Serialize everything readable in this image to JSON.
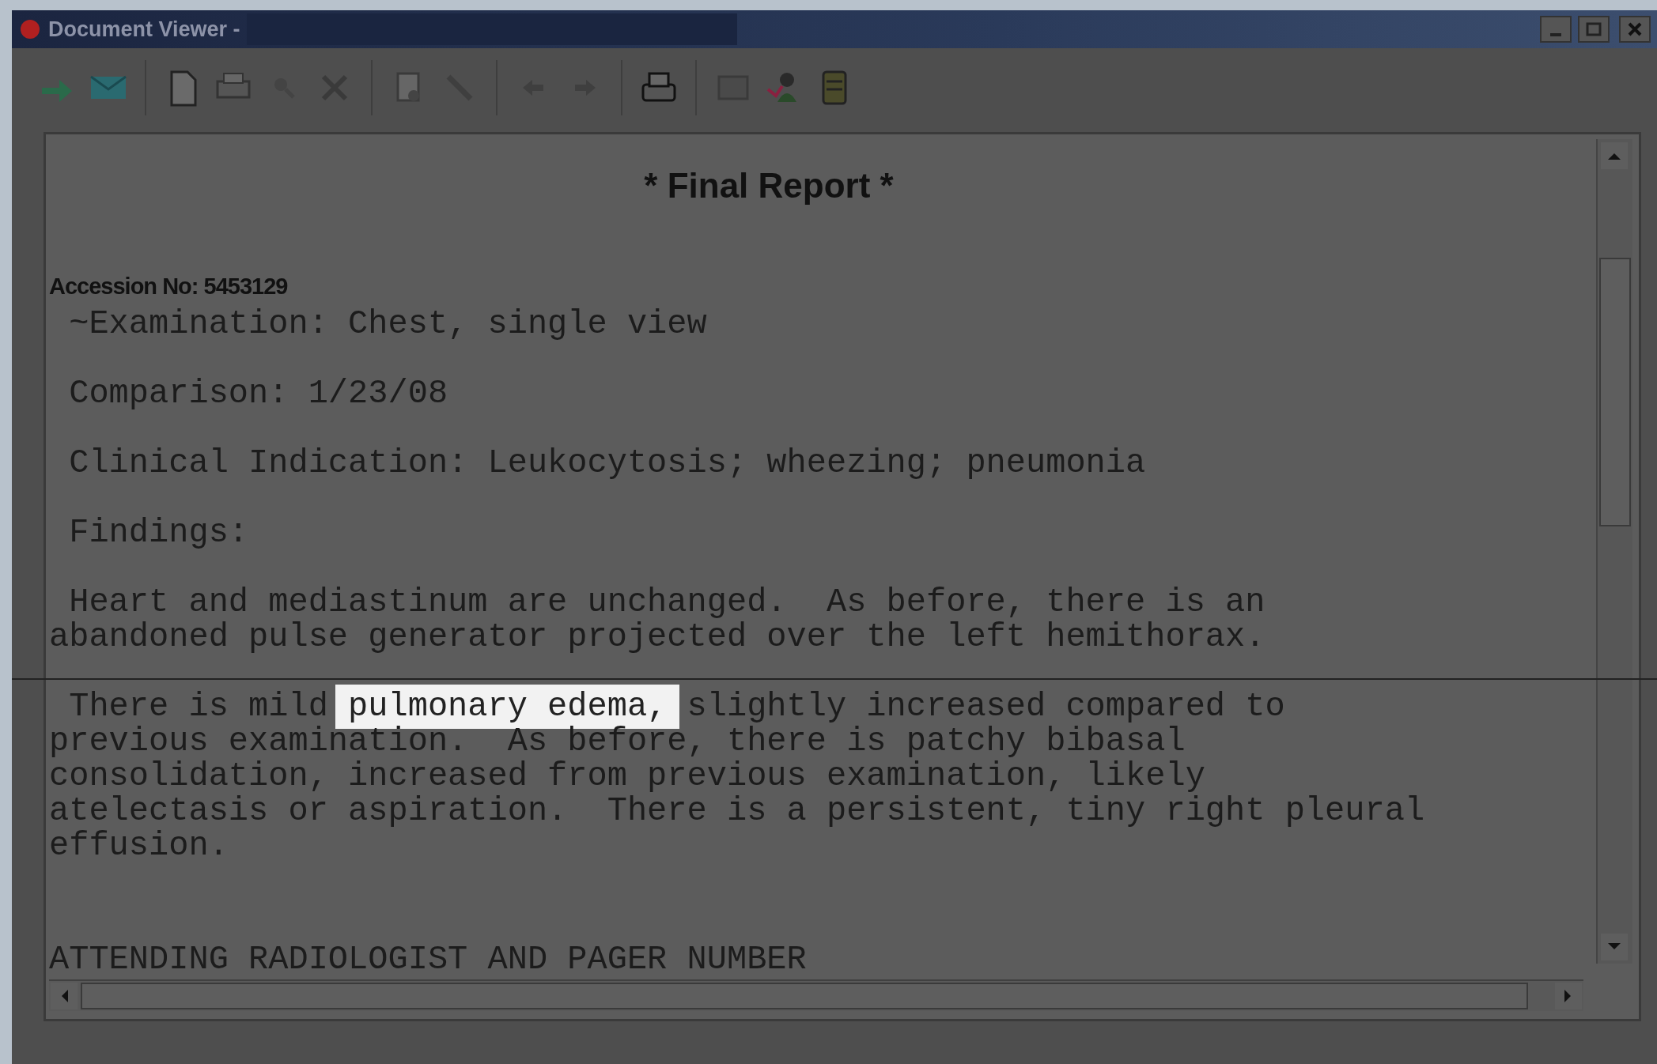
{
  "window": {
    "title": "Document Viewer -"
  },
  "document": {
    "title": "* Final Report *",
    "accession": "Accession No: 5453129",
    "paragraphs": [
      {
        "kind": "paragraph",
        "segments": [
          {
            "text": "~Examination: Chest, single view",
            "highlighted": false
          }
        ]
      },
      {
        "kind": "paragraph",
        "segments": [
          {
            "text": "Comparison: 1/23/08",
            "highlighted": false
          }
        ]
      },
      {
        "kind": "paragraph",
        "segments": [
          {
            "text": "Clinical Indication: Leukocytosis; wheezing; pneumonia",
            "highlighted": false
          }
        ]
      },
      {
        "kind": "paragraph",
        "segments": [
          {
            "text": "Findings:",
            "highlighted": false
          }
        ]
      },
      {
        "kind": "paragraph",
        "segments": [
          {
            "text": "Heart and mediastinum are unchanged.  As before, there is an\nabandoned pulse generator projected over the left hemithorax.",
            "highlighted": false
          }
        ]
      },
      {
        "kind": "paragraph",
        "segments": [
          {
            "text": "There is mild ",
            "highlighted": false
          },
          {
            "text": "pulmonary edema,",
            "highlighted": true
          },
          {
            "text": " slightly increased compared to\nprevious examination.  As before, there is patchy bibasal\nconsolidation, increased from previous examination, likely\natelectasis or aspiration.  There is a persistent, tiny right pleural\neffusion.",
            "highlighted": false
          }
        ]
      },
      {
        "kind": "heading",
        "segments": [
          {
            "text": "ATTENDING RADIOLOGIST AND PAGER NUMBER",
            "highlighted": false
          }
        ]
      }
    ]
  }
}
